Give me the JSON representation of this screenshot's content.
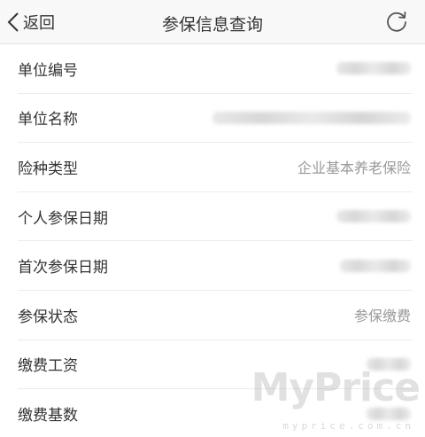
{
  "navbar": {
    "back_label": "返回",
    "title": "参保信息查询"
  },
  "rows": [
    {
      "label": "单位编号",
      "value": ""
    },
    {
      "label": "单位名称",
      "value": ""
    },
    {
      "label": "险种类型",
      "value": "企业基本养老保险"
    },
    {
      "label": "个人参保日期",
      "value": ""
    },
    {
      "label": "首次参保日期",
      "value": ""
    },
    {
      "label": "参保状态",
      "value": "参保缴费"
    },
    {
      "label": "缴费工资",
      "value": ""
    },
    {
      "label": "缴费基数",
      "value": ""
    }
  ],
  "watermark": {
    "brand": "MyPrice",
    "url": "myprice.com.cn"
  },
  "colors": {
    "navbar_bg": "#f8f8f8",
    "label_text": "#333333",
    "value_text": "#999999",
    "divider": "#ececec"
  }
}
